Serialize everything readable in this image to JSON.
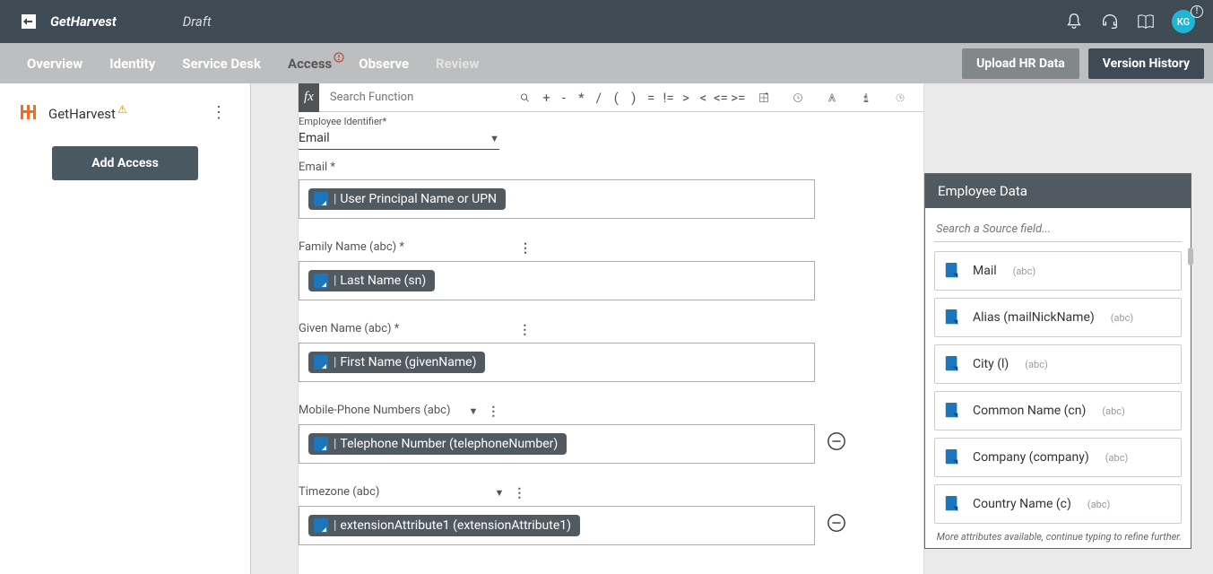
{
  "header": {
    "title": "GetHarvest",
    "status": "Draft",
    "avatar": "KG"
  },
  "tabs": {
    "overview": "Overview",
    "identity": "Identity",
    "service_desk": "Service Desk",
    "access": "Access",
    "observe": "Observe",
    "review": "Review",
    "upload_btn": "Upload HR Data",
    "history_btn": "Version History"
  },
  "sidebar": {
    "app_name": "GetHarvest",
    "add_access": "Add Access"
  },
  "formula": {
    "fx": "fx",
    "search_placeholder": "Search Function",
    "ops": [
      "+",
      "-",
      "*",
      "/",
      "(",
      ")",
      "=",
      "!=",
      ">",
      "<",
      "<=",
      ">="
    ]
  },
  "fields": {
    "emp_id_label": "Employee Identifier*",
    "emp_id_value": "Email",
    "email_label": "Email *",
    "email_chip": "User Principal Name or UPN",
    "family_label": "Family Name (abc) *",
    "family_chip": "Last Name (sn)",
    "given_label": "Given Name (abc) *",
    "given_chip": "First Name (givenName)",
    "mobile_label": "Mobile-Phone Numbers (abc)",
    "mobile_chip": "Telephone Number (telephoneNumber)",
    "tz_label": "Timezone (abc)",
    "tz_chip": "extensionAttribute1 (extensionAttribute1)"
  },
  "right": {
    "header": "Employee Data",
    "search_placeholder": "Search a Source field...",
    "type_abc": "(abc)",
    "items": {
      "mail": "Mail",
      "alias": "Alias (mailNickName)",
      "city": "City (l)",
      "cn": "Common Name (cn)",
      "company": "Company (company)",
      "country": "Country Name (c)"
    },
    "footer": "More attributes available, continue typing to refine further."
  }
}
